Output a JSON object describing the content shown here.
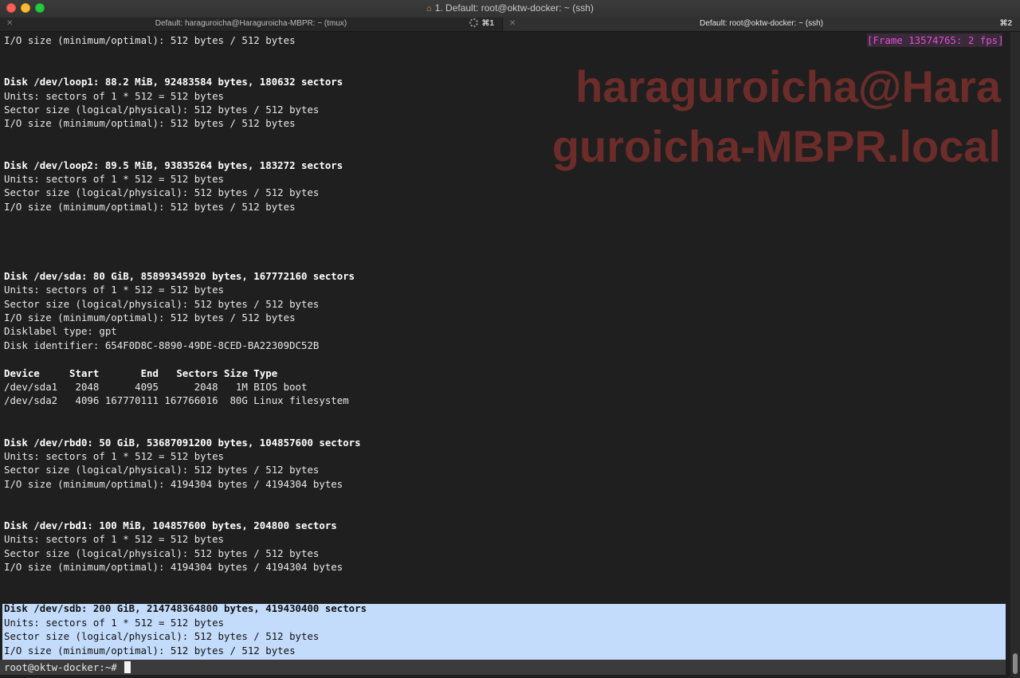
{
  "window": {
    "title": "1. Default: root@oktw-docker: ~ (ssh)",
    "home_icon": "home-icon"
  },
  "tabs": [
    {
      "label": "Default: haraguroicha@Haraguroicha-MBPR: ~ (tmux)",
      "shortcut": "⌘1",
      "activity": "spinner-icon"
    },
    {
      "label": "Default: root@oktw-docker: ~ (ssh)",
      "shortcut": "⌘2"
    }
  ],
  "badge": "[Frame 13574765: 2 fps]",
  "watermark": {
    "line1": "haraguroicha@Hara",
    "line2": "guroicha-MBPR.local"
  },
  "terminal": {
    "lines": [
      {
        "text": "I/O size (minimum/optimal): 512 bytes / 512 bytes",
        "bold": false
      },
      {
        "text": "",
        "bold": false
      },
      {
        "text": "",
        "bold": false
      },
      {
        "text": "Disk /dev/loop1: 88.2 MiB, 92483584 bytes, 180632 sectors",
        "bold": true
      },
      {
        "text": "Units: sectors of 1 * 512 = 512 bytes",
        "bold": false
      },
      {
        "text": "Sector size (logical/physical): 512 bytes / 512 bytes",
        "bold": false
      },
      {
        "text": "I/O size (minimum/optimal): 512 bytes / 512 bytes",
        "bold": false
      },
      {
        "text": "",
        "bold": false
      },
      {
        "text": "",
        "bold": false
      },
      {
        "text": "Disk /dev/loop2: 89.5 MiB, 93835264 bytes, 183272 sectors",
        "bold": true
      },
      {
        "text": "Units: sectors of 1 * 512 = 512 bytes",
        "bold": false
      },
      {
        "text": "Sector size (logical/physical): 512 bytes / 512 bytes",
        "bold": false
      },
      {
        "text": "I/O size (minimum/optimal): 512 bytes / 512 bytes",
        "bold": false
      },
      {
        "text": "",
        "bold": false
      },
      {
        "text": "",
        "bold": false
      },
      {
        "text": "",
        "bold": false
      },
      {
        "text": "",
        "bold": false
      },
      {
        "text": "Disk /dev/sda: 80 GiB, 85899345920 bytes, 167772160 sectors",
        "bold": true
      },
      {
        "text": "Units: sectors of 1 * 512 = 512 bytes",
        "bold": false
      },
      {
        "text": "Sector size (logical/physical): 512 bytes / 512 bytes",
        "bold": false
      },
      {
        "text": "I/O size (minimum/optimal): 512 bytes / 512 bytes",
        "bold": false
      },
      {
        "text": "Disklabel type: gpt",
        "bold": false
      },
      {
        "text": "Disk identifier: 654F0D8C-8890-49DE-8CED-BA22309DC52B",
        "bold": false
      },
      {
        "text": "",
        "bold": false
      },
      {
        "text": "Device     Start       End   Sectors Size Type",
        "bold": true
      },
      {
        "text": "/dev/sda1   2048      4095      2048   1M BIOS boot",
        "bold": false
      },
      {
        "text": "/dev/sda2   4096 167770111 167766016  80G Linux filesystem",
        "bold": false
      },
      {
        "text": "",
        "bold": false
      },
      {
        "text": "",
        "bold": false
      },
      {
        "text": "Disk /dev/rbd0: 50 GiB, 53687091200 bytes, 104857600 sectors",
        "bold": true
      },
      {
        "text": "Units: sectors of 1 * 512 = 512 bytes",
        "bold": false
      },
      {
        "text": "Sector size (logical/physical): 512 bytes / 512 bytes",
        "bold": false
      },
      {
        "text": "I/O size (minimum/optimal): 4194304 bytes / 4194304 bytes",
        "bold": false
      },
      {
        "text": "",
        "bold": false
      },
      {
        "text": "",
        "bold": false
      },
      {
        "text": "Disk /dev/rbd1: 100 MiB, 104857600 bytes, 204800 sectors",
        "bold": true
      },
      {
        "text": "Units: sectors of 1 * 512 = 512 bytes",
        "bold": false
      },
      {
        "text": "Sector size (logical/physical): 512 bytes / 512 bytes",
        "bold": false
      },
      {
        "text": "I/O size (minimum/optimal): 4194304 bytes / 4194304 bytes",
        "bold": false
      },
      {
        "text": "",
        "bold": false
      },
      {
        "text": "",
        "bold": false
      },
      {
        "text": "Disk /dev/sdb: 200 GiB, 214748364800 bytes, 419430400 sectors",
        "bold": true,
        "selected": true
      },
      {
        "text": "Units: sectors of 1 * 512 = 512 bytes",
        "bold": false,
        "selected": true
      },
      {
        "text": "Sector size (logical/physical): 512 bytes / 512 bytes",
        "bold": false,
        "selected": true
      },
      {
        "text": "I/O size (minimum/optimal): 512 bytes / 512 bytes",
        "bold": false,
        "selected": true
      }
    ],
    "prompt": "root@oktw-docker:~# "
  },
  "colors": {
    "background": "#1f1f1f",
    "text": "#e8e8e8",
    "selection": "#c4dcfb",
    "badge_text": "#e04fd2",
    "watermark": "#6b2c2a"
  }
}
